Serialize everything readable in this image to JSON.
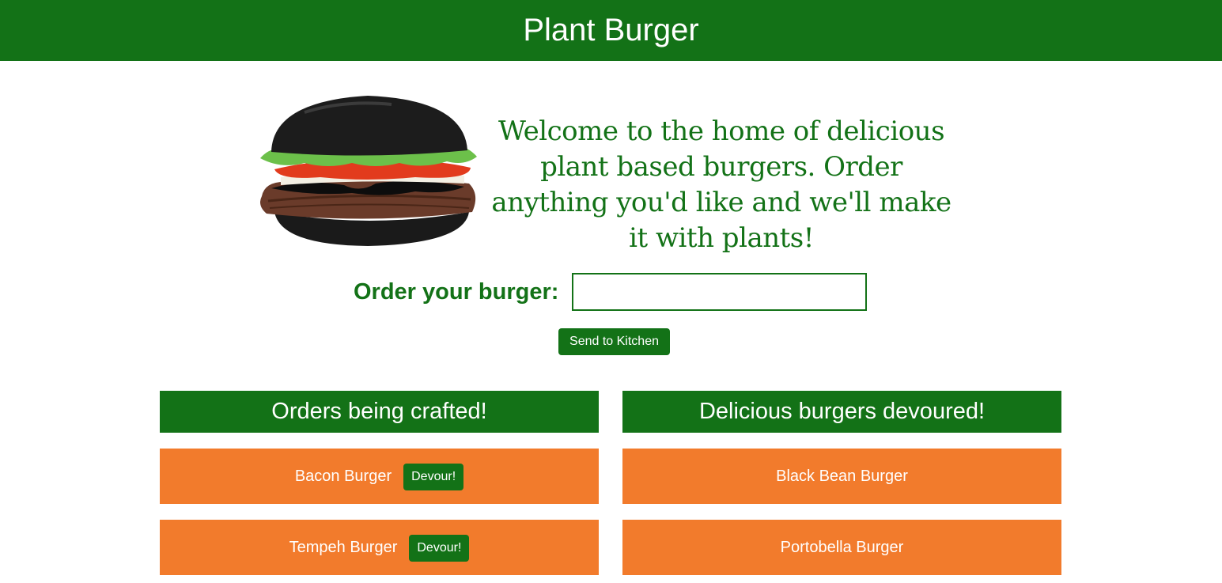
{
  "header": {
    "title": "Plant Burger"
  },
  "hero": {
    "image": "burger-photo",
    "welcome_text": "Welcome to the home of delicious plant based burgers. Order anything you'd like and we'll make it with plants!"
  },
  "order_form": {
    "label": "Order your burger:",
    "input_value": "",
    "submit_label": "Send to Kitchen"
  },
  "crafting": {
    "heading": "Orders being crafted!",
    "items": [
      {
        "name": "Bacon Burger",
        "action": "Devour!"
      },
      {
        "name": "Tempeh Burger",
        "action": "Devour!"
      }
    ]
  },
  "devoured": {
    "heading": "Delicious burgers devoured!",
    "items": [
      {
        "name": "Black Bean Burger"
      },
      {
        "name": "Portobella Burger"
      }
    ]
  },
  "colors": {
    "primary_green": "#137217",
    "card_orange": "#f27b2c",
    "background": "#ffffff"
  }
}
